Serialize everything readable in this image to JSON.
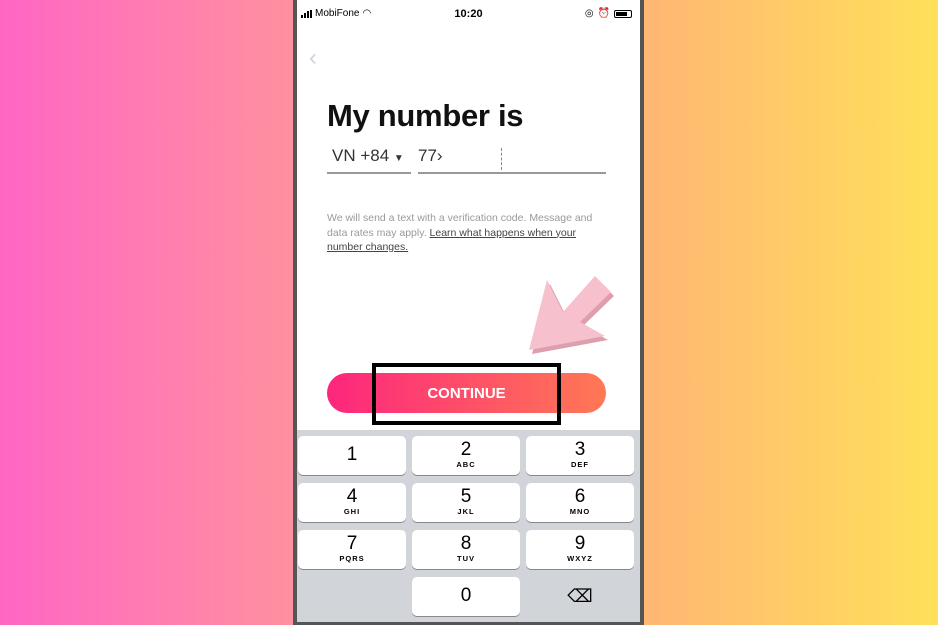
{
  "status": {
    "carrier": "MobiFone",
    "time": "10:20"
  },
  "title": "My number is",
  "country_code": "VN +84",
  "phone_value": "77›",
  "info_text": "We will send a text with a verification code. Message and data rates may apply. ",
  "info_link": "Learn what happens when your number changes.",
  "continue_label": "CONTINUE",
  "keys": [
    {
      "d": "1",
      "l": ""
    },
    {
      "d": "2",
      "l": "ABC"
    },
    {
      "d": "3",
      "l": "DEF"
    },
    {
      "d": "4",
      "l": "GHI"
    },
    {
      "d": "5",
      "l": "JKL"
    },
    {
      "d": "6",
      "l": "MNO"
    },
    {
      "d": "7",
      "l": "PQRS"
    },
    {
      "d": "8",
      "l": "TUV"
    },
    {
      "d": "9",
      "l": "WXYZ"
    },
    {
      "d": "0",
      "l": ""
    }
  ],
  "colors": {
    "gradient_start": "#fd267d",
    "gradient_end": "#ff7854",
    "arrow": "#f6c1cc"
  }
}
